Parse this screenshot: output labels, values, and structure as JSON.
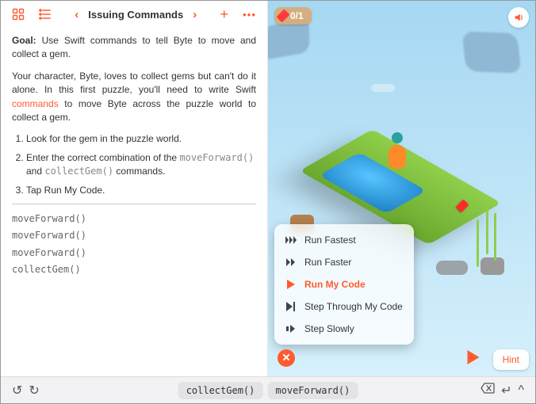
{
  "toolbar": {
    "title": "Issuing Commands"
  },
  "instructions": {
    "goal_label": "Goal:",
    "goal_text": " Use Swift commands to tell Byte to move and collect a gem.",
    "intro_before_link": "Your character, Byte, loves to collect gems but can't do it alone. In this first puzzle, you'll need to write Swift ",
    "link_text": "commands",
    "intro_after_link": " to move Byte across the puzzle world to collect a gem.",
    "steps": [
      "Look for the gem in the puzzle world.",
      "Enter the correct combination of the ",
      "Tap Run My Code."
    ],
    "step2_code1": "moveForward()",
    "step2_mid": " and ",
    "step2_code2": "collectGem()",
    "step2_tail": " commands."
  },
  "code_lines": [
    "moveForward()",
    "moveForward()",
    "moveForward()",
    "collectGem()"
  ],
  "world": {
    "gem_count": "0/1"
  },
  "run_menu": {
    "items": [
      {
        "label": "Run Fastest",
        "icon": "▸▸▸"
      },
      {
        "label": "Run Faster",
        "icon": "▸▸"
      },
      {
        "label": "Run My Code",
        "icon": "▶",
        "selected": true
      },
      {
        "label": "Step Through My Code",
        "icon": "▶|"
      },
      {
        "label": "Step Slowly",
        "icon": "▪▶"
      }
    ]
  },
  "controls": {
    "hint": "Hint"
  },
  "bottom": {
    "suggestions": [
      "collectGem()",
      "moveForward()"
    ]
  }
}
